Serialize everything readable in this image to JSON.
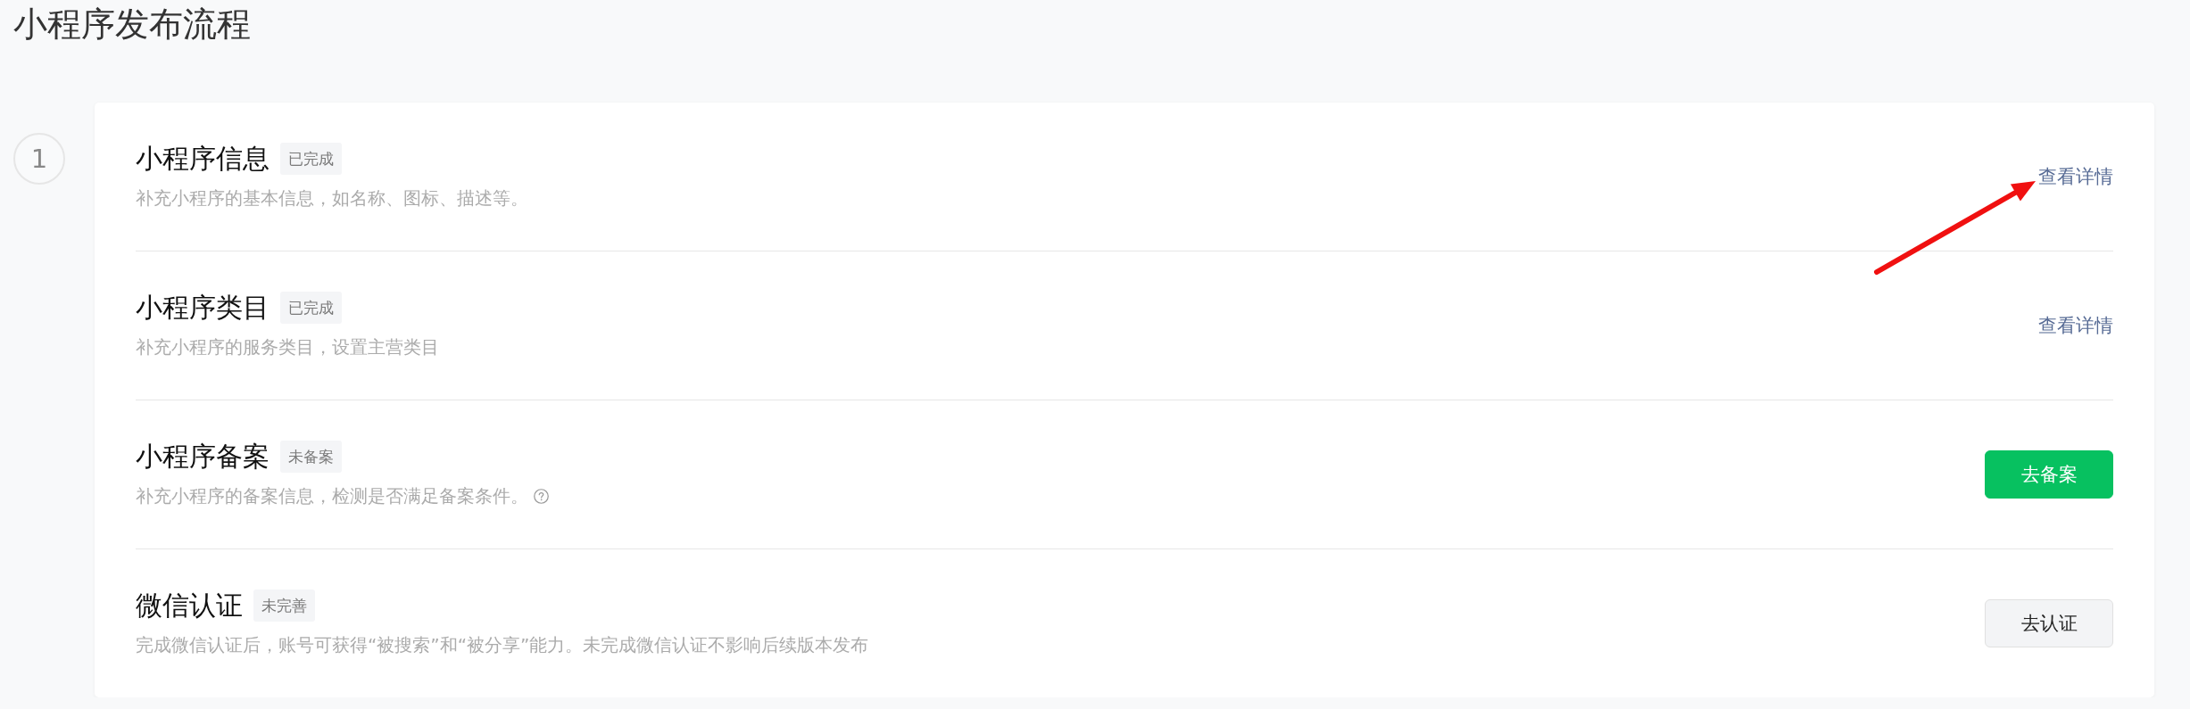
{
  "title": "小程序发布流程",
  "step": {
    "number": "1"
  },
  "items": [
    {
      "title": "小程序信息",
      "status": "已完成",
      "description": "补充小程序的基本信息，如名称、图标、描述等。",
      "help": false,
      "action": {
        "kind": "link",
        "label": "查看详情"
      }
    },
    {
      "title": "小程序类目",
      "status": "已完成",
      "description": "补充小程序的服务类目，设置主营类目",
      "help": false,
      "action": {
        "kind": "link",
        "label": "查看详情"
      }
    },
    {
      "title": "小程序备案",
      "status": "未备案",
      "description": "补充小程序的备案信息，检测是否满足备案条件。",
      "help": true,
      "action": {
        "kind": "primary",
        "label": "去备案"
      }
    },
    {
      "title": "微信认证",
      "status": "未完善",
      "description": "完成微信认证后，账号可获得“被搜索”和“被分享”能力。未完成微信认证不影响后续版本发布",
      "help": false,
      "action": {
        "kind": "default",
        "label": "去认证"
      }
    }
  ],
  "annotations": [
    {
      "kind": "arrow"
    }
  ]
}
